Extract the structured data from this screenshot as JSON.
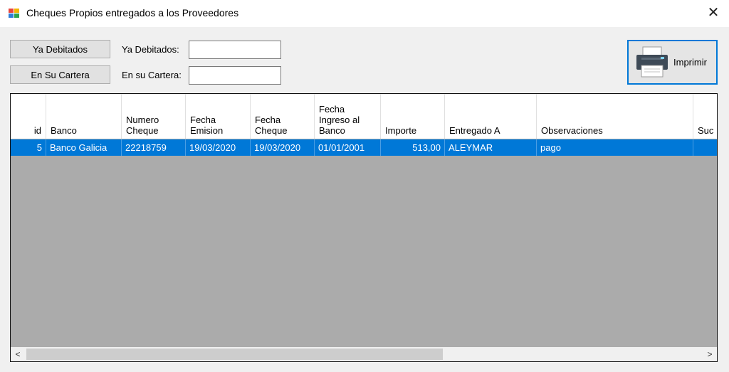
{
  "window": {
    "title": "Cheques Propios entregados a los Proveedores",
    "close_glyph": "✕"
  },
  "filters": {
    "ya_debitados_button": "Ya Debitados",
    "en_su_cartera_button": "En Su Cartera",
    "ya_debitados_label": "Ya Debitados:",
    "en_su_cartera_label": "En su Cartera:",
    "ya_debitados_value": "",
    "en_su_cartera_value": ""
  },
  "print_button": {
    "label": "Imprimir",
    "icon": "printer-icon"
  },
  "grid": {
    "columns": [
      "id",
      "Banco",
      "Numero\nCheque",
      "Fecha\nEmision",
      "Fecha\nCheque",
      "Fecha\nIngreso al\nBanco",
      "Importe",
      "Entregado A",
      "Observaciones",
      "Suc"
    ],
    "rows": [
      [
        "5",
        "Banco Galicia",
        "22218759",
        "19/03/2020",
        "19/03/2020",
        "01/01/2001",
        "513,00",
        "ALEYMAR",
        "pago",
        ""
      ]
    ]
  },
  "scrollbar": {
    "left_arrow": "<",
    "right_arrow": ">"
  },
  "colors": {
    "selection": "#0078d7",
    "grid_background": "#ababab",
    "accent": "#0078d7"
  }
}
